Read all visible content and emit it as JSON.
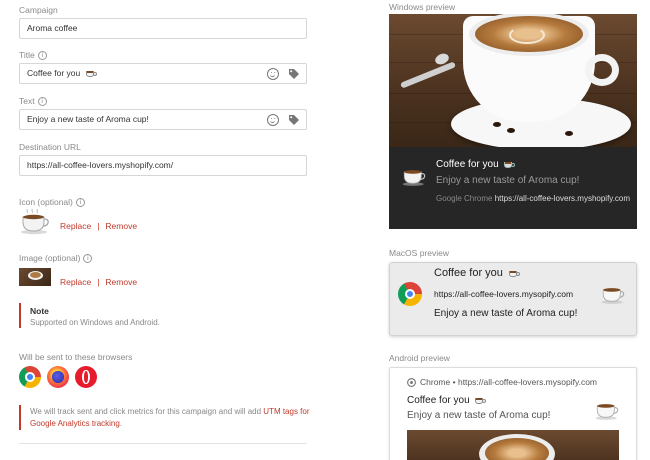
{
  "form": {
    "campaign": {
      "label": "Campaign",
      "value": "Aroma coffee"
    },
    "title": {
      "label": "Title",
      "value": "Coffee for you"
    },
    "text": {
      "label": "Text",
      "value": "Enjoy a new taste of Aroma cup!"
    },
    "destination": {
      "label": "Destination URL",
      "value": "https://all-coffee-lovers.myshopify.com/"
    },
    "icon": {
      "label": "Icon (optional)",
      "replace": "Replace",
      "separator": "|",
      "remove": "Remove"
    },
    "image": {
      "label": "Image (optional)",
      "replace": "Replace",
      "separator": "|",
      "remove": "Remove"
    },
    "note": {
      "title": "Note",
      "text": "Supported on Windows and Android."
    },
    "browsers": {
      "label": "Will be sent to these browsers",
      "items": [
        "chrome-icon",
        "firefox-icon",
        "opera-icon"
      ]
    },
    "tracking": {
      "text_before": "We will track sent and click metrics for this campaign and will add ",
      "utm_link": "UTM tags for Google Analytics tracking",
      "text_after": "."
    }
  },
  "previews": {
    "windows": {
      "label": "Windows preview",
      "title": "Coffee for you",
      "body": "Enjoy a new taste of Aroma cup!",
      "source_prefix": "Google Chrome",
      "source_url": "https://all-coffee-lovers.myshopify.com"
    },
    "macos": {
      "label": "MacOS preview",
      "title": "Coffee for you",
      "url": "https://all-coffee-lovers.mysopify.com",
      "body": "Enjoy a new taste of Aroma cup!"
    },
    "android": {
      "label": "Android preview",
      "app": "Chrome",
      "bullet": "•",
      "url": "https://all-coffee-lovers.mysopify.com",
      "title": "Coffee for you",
      "body": "Enjoy a new taste of Aroma cup!"
    }
  },
  "colors": {
    "accent_red": "#c0392b",
    "dark_panel": "#262626",
    "link_text": "#c0392b"
  }
}
